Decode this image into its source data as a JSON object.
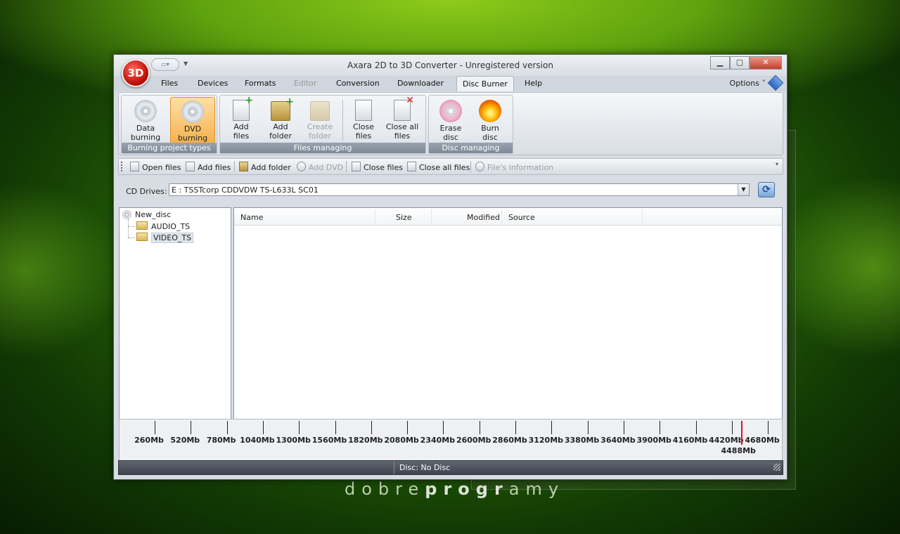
{
  "window": {
    "title": "Axara 2D to 3D Converter - Unregistered version",
    "logo_text": "3D"
  },
  "menu_tabs": [
    {
      "label": "Files"
    },
    {
      "label": "Devices"
    },
    {
      "label": "Formats"
    },
    {
      "label": "Editor",
      "disabled": true
    },
    {
      "label": "Conversion"
    },
    {
      "label": "Downloader"
    },
    {
      "label": "Disc Burner",
      "active": true
    },
    {
      "label": "Help"
    }
  ],
  "options_label": "Options",
  "ribbon": {
    "groups": [
      {
        "label": "Burning project types",
        "buttons": [
          {
            "label": "Data\nburning",
            "l1": "Data",
            "l2": "burning"
          },
          {
            "label": "DVD burning",
            "l1": "DVD",
            "l2": "burning",
            "active": true
          }
        ]
      },
      {
        "label": "Files managing",
        "buttons": [
          {
            "l1": "Add",
            "l2": "files"
          },
          {
            "l1": "Add",
            "l2": "folder"
          },
          {
            "l1": "Create",
            "l2": "folder",
            "disabled": true
          },
          {
            "l1": "Close",
            "l2": "files"
          },
          {
            "l1": "Close all",
            "l2": "files"
          }
        ]
      },
      {
        "label": "Disc managing",
        "buttons": [
          {
            "l1": "Erase",
            "l2": "disc"
          },
          {
            "l1": "Burn",
            "l2": "disc"
          }
        ]
      }
    ]
  },
  "toolbar": {
    "open_files": "Open files",
    "add_files": "Add files",
    "add_folder": "Add folder",
    "add_dvd": "Add DVD",
    "close_files": "Close files",
    "close_all_files": "Close all files",
    "files_information": "File's information"
  },
  "cd_drives": {
    "label": "CD Drives:",
    "value": "E : TSSTcorp CDDVDW TS-L633L  SC01"
  },
  "tree": {
    "root": "New_disc",
    "children": [
      "AUDIO_TS",
      "VIDEO_TS"
    ],
    "selected": "VIDEO_TS"
  },
  "file_list": {
    "columns": [
      "Name",
      "Size",
      "Modified",
      "Source"
    ],
    "rows": []
  },
  "disc_scale": {
    "ticks": [
      "260Mb",
      "520Mb",
      "780Mb",
      "1040Mb",
      "1300Mb",
      "1560Mb",
      "1820Mb",
      "2080Mb",
      "2340Mb",
      "2600Mb",
      "2860Mb",
      "3120Mb",
      "3380Mb",
      "3640Mb",
      "3900Mb",
      "4160Mb",
      "4420Mb",
      "4680Mb"
    ],
    "marker_label": "4488Mb",
    "marker_value_mb": 4488
  },
  "status": {
    "text": "Disc: No Disc"
  },
  "watermark": {
    "part1": "dobre",
    "part2": "progr",
    "part3": "amy"
  },
  "colors": {
    "accent_tab": "#eef1f5",
    "marker": "#e0101a",
    "active_button": "#f5b24c"
  }
}
